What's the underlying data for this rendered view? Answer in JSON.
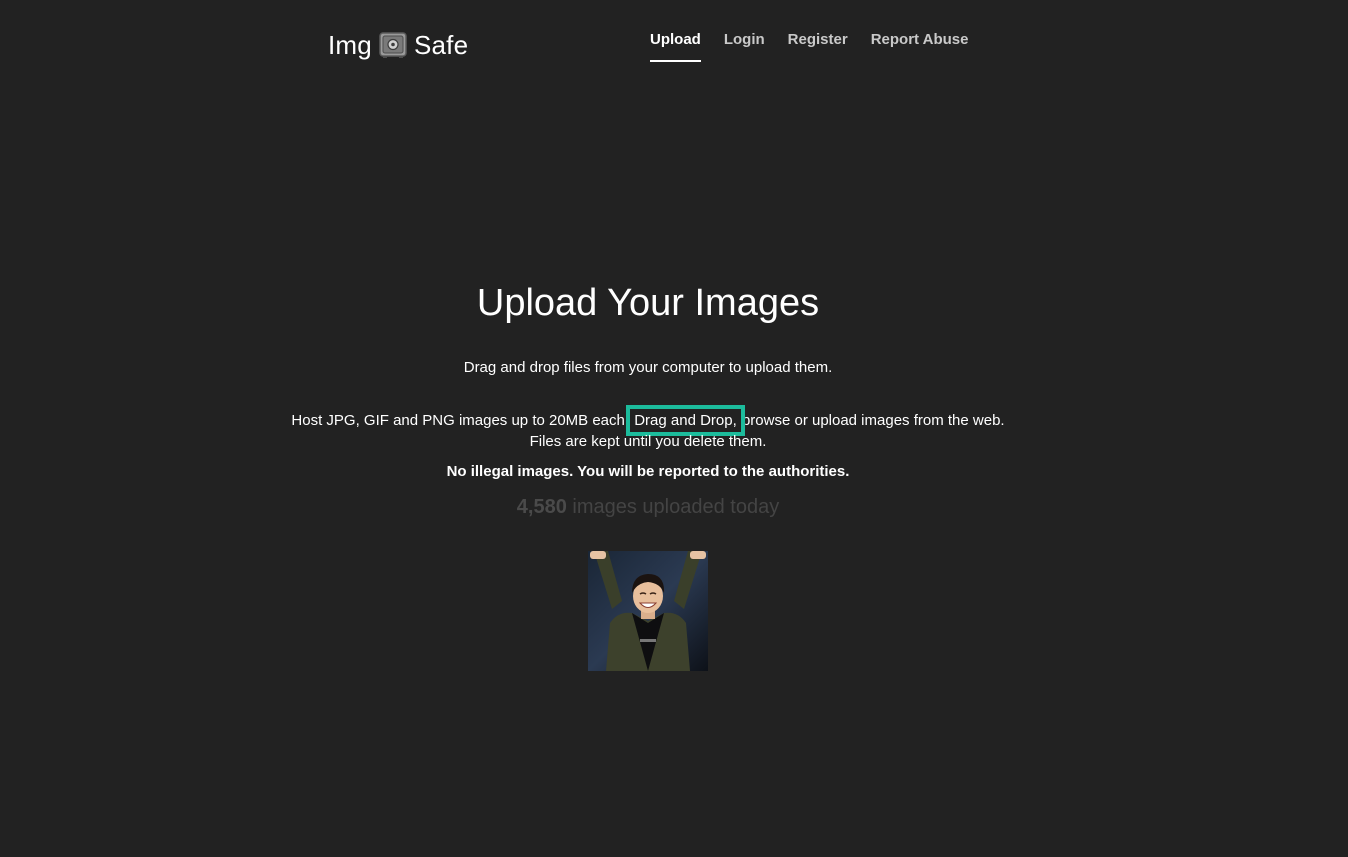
{
  "header": {
    "logo_left": "Img",
    "logo_icon": "safe-icon",
    "logo_right": "Safe",
    "nav": [
      {
        "label": "Upload",
        "active": true
      },
      {
        "label": "Login",
        "active": false
      },
      {
        "label": "Register",
        "active": false
      },
      {
        "label": "Report Abuse",
        "active": false
      }
    ]
  },
  "main": {
    "title": "Upload Your Images",
    "subtitle": "Drag and drop files from your computer to upload them.",
    "info_before": "Host JPG, GIF and PNG images up to 20MB each.",
    "info_link": "Drag and Drop,",
    "info_after": " browse or upload images from the web.",
    "info_line2": "Files are kept until you delete them.",
    "warning": "No illegal images. You will be reported to the authorities.",
    "count": "4,580",
    "count_suffix": " images uploaded today"
  },
  "colors": {
    "background": "#222222",
    "highlight": "#1cbc9c",
    "counter": "#444444"
  }
}
